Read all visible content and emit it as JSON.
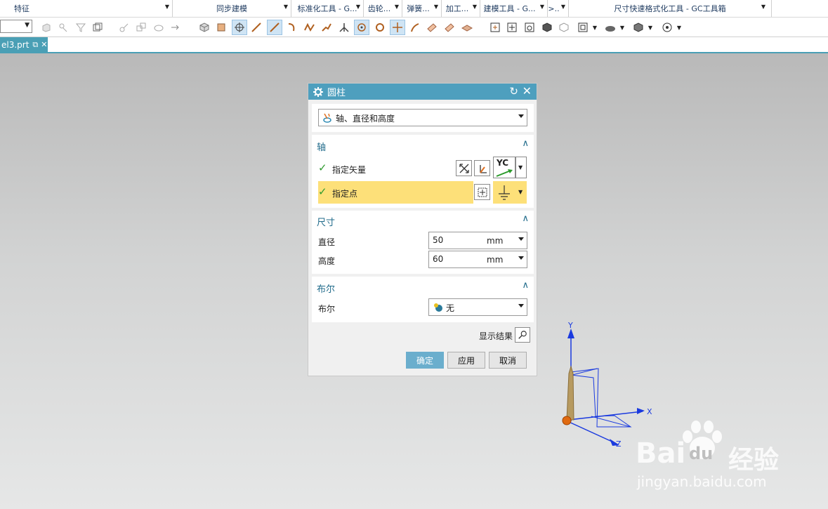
{
  "ribbon": {
    "groups": [
      {
        "label": "特征"
      },
      {
        "label": "同步建模"
      },
      {
        "label": "标准化工具 - G..."
      },
      {
        "label": "齿轮..."
      },
      {
        "label": "弹簧..."
      },
      {
        "label": "加工..."
      },
      {
        "label": "建模工具 - G..."
      },
      {
        "label": ">.."
      },
      {
        "label": "尺寸快速格式化工具 - GC工具箱"
      }
    ]
  },
  "file_tab": {
    "label": "el3.prt"
  },
  "dialog": {
    "title": "圆柱",
    "type_value": "轴、直径和高度",
    "axis": {
      "header": "轴",
      "specify_vector": "指定矢量",
      "vector_value": "YC",
      "specify_point": "指定点"
    },
    "dimensions": {
      "header": "尺寸",
      "diameter_label": "直径",
      "diameter_value": "50",
      "diameter_unit": "mm",
      "height_label": "高度",
      "height_value": "60",
      "height_unit": "mm"
    },
    "boolean": {
      "header": "布尔",
      "label": "布尔",
      "value": "无"
    },
    "show_result": "显示结果",
    "buttons": {
      "ok": "确定",
      "apply": "应用",
      "cancel": "取消"
    }
  },
  "triad": {
    "x": "X",
    "y": "Y",
    "z": "Z"
  },
  "watermark": {
    "brand_a": "Bai",
    "brand_b": "du",
    "brand_c": "经验",
    "url": "jingyan.baidu.com"
  }
}
